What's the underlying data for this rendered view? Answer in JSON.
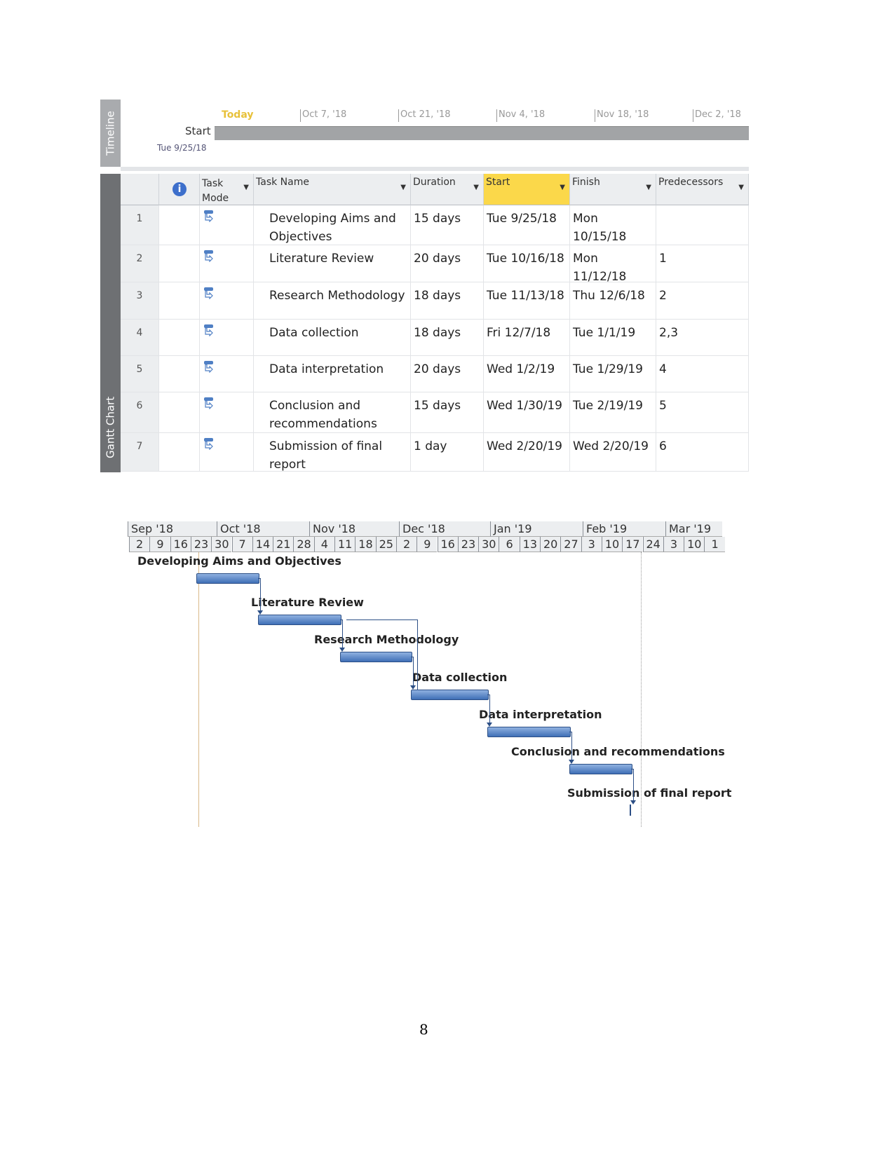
{
  "timeline": {
    "panel_label": "Timeline",
    "today_label": "Today",
    "start_label": "Start",
    "start_date": "Tue 9/25/18",
    "ticks": [
      "Oct 7, '18",
      "Oct 21, '18",
      "Nov 4, '18",
      "Nov 18, '18",
      "Dec 2, '18"
    ]
  },
  "table": {
    "panel_label": "Gantt Chart",
    "headers": {
      "task_mode": "Task Mode",
      "task_name": "Task Name",
      "duration": "Duration",
      "start": "Start",
      "finish": "Finish",
      "predecessors": "Predecessors"
    },
    "rows": [
      {
        "id": "1",
        "name": "Developing Aims and Objectives",
        "duration": "15 days",
        "start": "Tue 9/25/18",
        "finish": "Mon 10/15/18",
        "pred": ""
      },
      {
        "id": "2",
        "name": "Literature Review",
        "duration": "20 days",
        "start": "Tue 10/16/18",
        "finish": "Mon 11/12/18",
        "pred": "1"
      },
      {
        "id": "3",
        "name": "Research Methodology",
        "duration": "18 days",
        "start": "Tue 11/13/18",
        "finish": "Thu 12/6/18",
        "pred": "2"
      },
      {
        "id": "4",
        "name": "Data collection",
        "duration": "18 days",
        "start": "Fri 12/7/18",
        "finish": "Tue 1/1/19",
        "pred": "2,3"
      },
      {
        "id": "5",
        "name": "Data interpretation",
        "duration": "20 days",
        "start": "Wed 1/2/19",
        "finish": "Tue 1/29/19",
        "pred": "4"
      },
      {
        "id": "6",
        "name": "Conclusion and recommendations",
        "duration": "15 days",
        "start": "Wed 1/30/19",
        "finish": "Tue 2/19/19",
        "pred": "5"
      },
      {
        "id": "7",
        "name": "Submission of final report",
        "duration": "1 day",
        "start": "Wed 2/20/19",
        "finish": "Wed 2/20/19",
        "pred": "6"
      }
    ]
  },
  "gantt": {
    "months": [
      "Sep '18",
      "Oct '18",
      "Nov '18",
      "Dec '18",
      "Jan '19",
      "Feb '19",
      "Mar '19"
    ],
    "weeks": [
      "2",
      "9",
      "16",
      "23",
      "30",
      "7",
      "14",
      "21",
      "28",
      "4",
      "11",
      "18",
      "25",
      "2",
      "9",
      "16",
      "23",
      "30",
      "6",
      "13",
      "20",
      "27",
      "3",
      "10",
      "17",
      "24",
      "3",
      "10",
      "1"
    ],
    "tasks": [
      {
        "label": "Developing Aims and Objectives",
        "start": "2018-09-25",
        "finish": "2018-10-15"
      },
      {
        "label": "Literature Review",
        "start": "2018-10-16",
        "finish": "2018-11-12"
      },
      {
        "label": "Research Methodology",
        "start": "2018-11-13",
        "finish": "2018-12-06"
      },
      {
        "label": "Data collection",
        "start": "2018-12-07",
        "finish": "2019-01-01"
      },
      {
        "label": "Data interpretation",
        "start": "2019-01-02",
        "finish": "2019-01-29"
      },
      {
        "label": "Conclusion and recommendations",
        "start": "2019-01-30",
        "finish": "2019-02-19"
      },
      {
        "label": "Submission of final report",
        "start": "2019-02-20",
        "finish": "2019-02-20",
        "milestone": true
      }
    ],
    "bar_color": "#4f7fc4"
  },
  "page_number": "8"
}
